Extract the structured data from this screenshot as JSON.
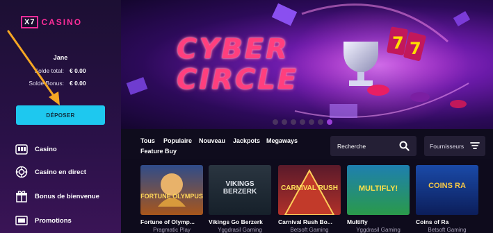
{
  "logo": {
    "box": "X7",
    "text": "CASINO"
  },
  "user": {
    "name": "Jane",
    "total_label": "Solde total:",
    "total_value": "€ 0.00",
    "bonus_label": "Solde Bonus:",
    "bonus_value": "€ 0.00"
  },
  "deposit_label": "DÉPOSER",
  "nav": [
    {
      "label": "Casino",
      "icon": "slot-machine-icon"
    },
    {
      "label": "Casino en direct",
      "icon": "chip-icon"
    },
    {
      "label": "Bonus de bienvenue",
      "icon": "gift-icon"
    },
    {
      "label": "Promotions",
      "icon": "promo-icon"
    }
  ],
  "banner": {
    "line1": "CYBER",
    "line2": "CIRCLE",
    "slides": 7,
    "active_slide": 7
  },
  "categories": [
    "Tous",
    "Populaire",
    "Nouveau",
    "Jackpots",
    "Megaways",
    "Feature Buy"
  ],
  "search": {
    "placeholder": "Recherche"
  },
  "providers_label": "Fournisseurs",
  "games": [
    {
      "name": "Fortune of Olymp...",
      "provider": "Pragmatic Play",
      "art": "FORTUNE OLYMPUS"
    },
    {
      "name": "Vikings Go Berzerk",
      "provider": "Yggdrasil Gaming",
      "art": "VIKINGS BERZERK"
    },
    {
      "name": "Carnival Rush Bo...",
      "provider": "Betsoft Gaming",
      "art": "CARNIVAL RUSH"
    },
    {
      "name": "Multifly",
      "provider": "Yggdrasil Gaming",
      "art": "MULTIFLY!"
    },
    {
      "name": "Coins of Ra",
      "provider": "Betsoft Gaming",
      "art": "COINS RA"
    }
  ],
  "colors": {
    "accent": "#1ec8ef",
    "brand": "#ff2d9a",
    "arrow": "#f5a623"
  }
}
